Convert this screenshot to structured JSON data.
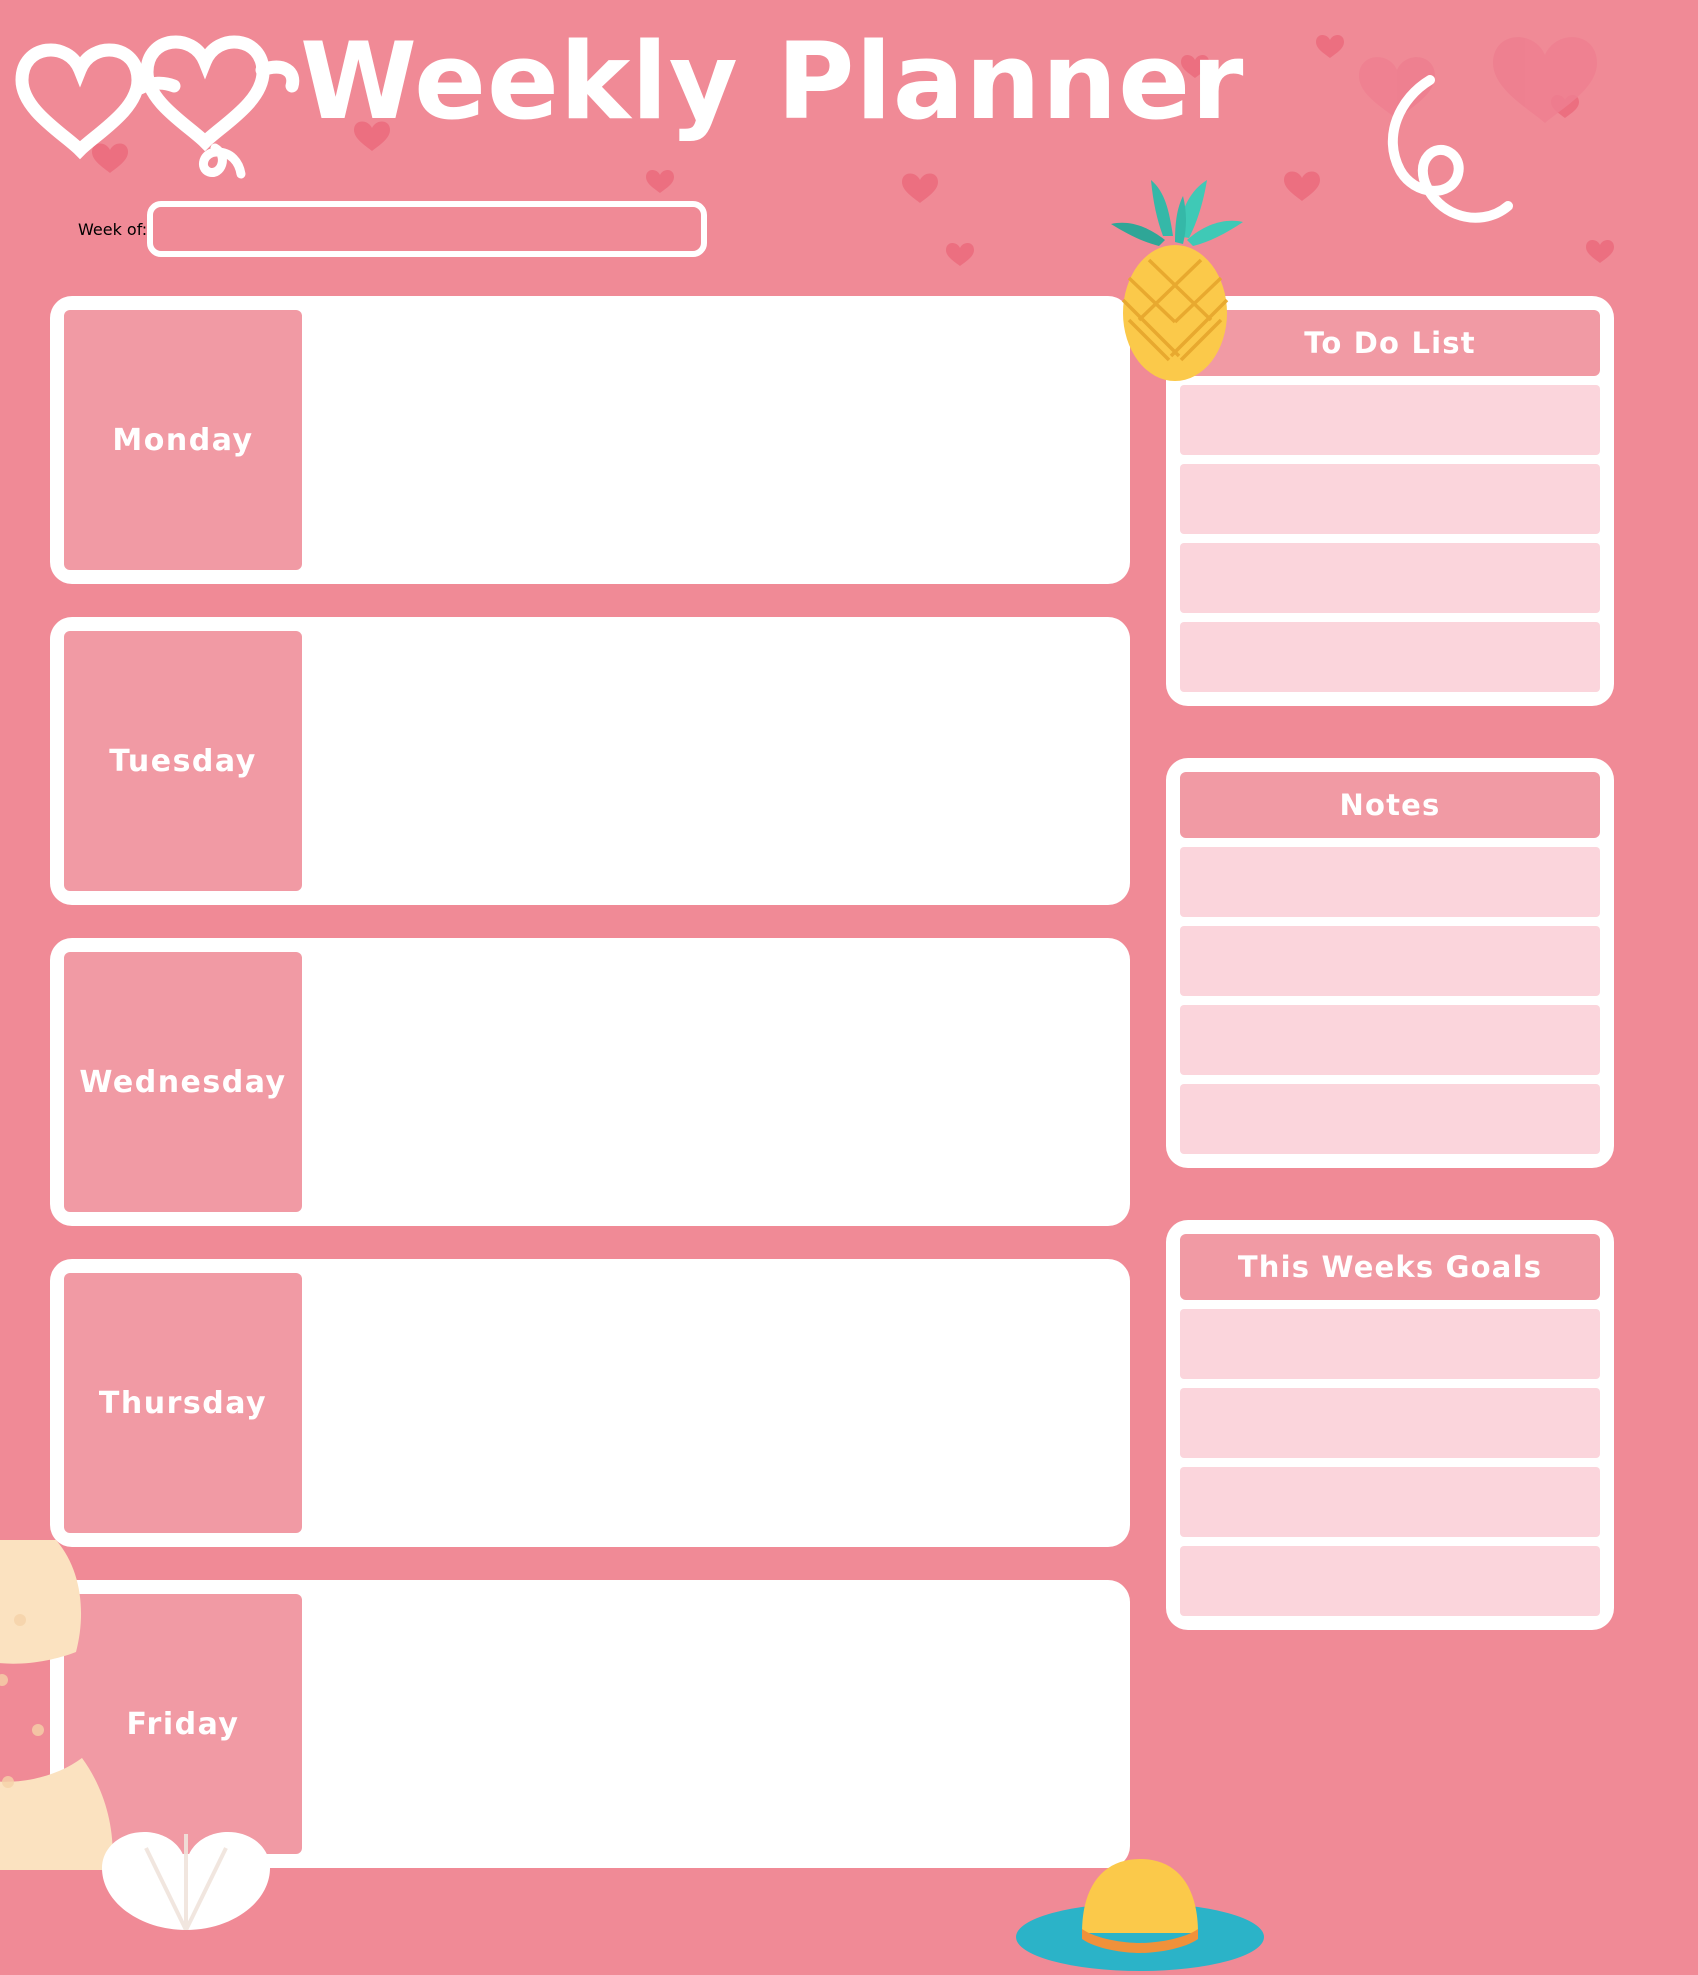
{
  "page": {
    "title": "Weekly Planner",
    "background_color": "#F08A96",
    "accent_color": "#F19AA4",
    "row_fill_color": "#FBD5DC",
    "card_color": "#FFFFFF"
  },
  "header": {
    "title": "Weekly Planner",
    "week_of_label": "Week of:",
    "week_of_value": "",
    "week_of_placeholder": ""
  },
  "days": [
    {
      "label": "Monday",
      "content": ""
    },
    {
      "label": "Tuesday",
      "content": ""
    },
    {
      "label": "Wednesday",
      "content": ""
    },
    {
      "label": "Thursday",
      "content": ""
    },
    {
      "label": "Friday",
      "content": ""
    }
  ],
  "panels": [
    {
      "title": "To Do List",
      "rows": [
        "",
        "",
        "",
        ""
      ]
    },
    {
      "title": "Notes",
      "rows": [
        "",
        "",
        "",
        ""
      ]
    },
    {
      "title": "This Weeks Goals",
      "rows": [
        "",
        "",
        "",
        ""
      ]
    }
  ],
  "decorations": {
    "sunglasses": "heart-sunglasses-icon",
    "pineapple": "pineapple-icon",
    "sunhat": "sun-hat-icon",
    "starfish": "starfish-icon",
    "shell": "seashell-icon",
    "hearts": "heart-icon",
    "squiggle": "squiggle-icon",
    "heart_color": "#EC6F80",
    "pineapple_body_color": "#FBC94A",
    "pineapple_leaf_color": "#35B8A8",
    "hat_brim_color": "#2BB3C8",
    "hat_crown_color": "#FBC94A",
    "hat_band_color": "#F0913A",
    "starfish_color": "#FBE2C0"
  }
}
